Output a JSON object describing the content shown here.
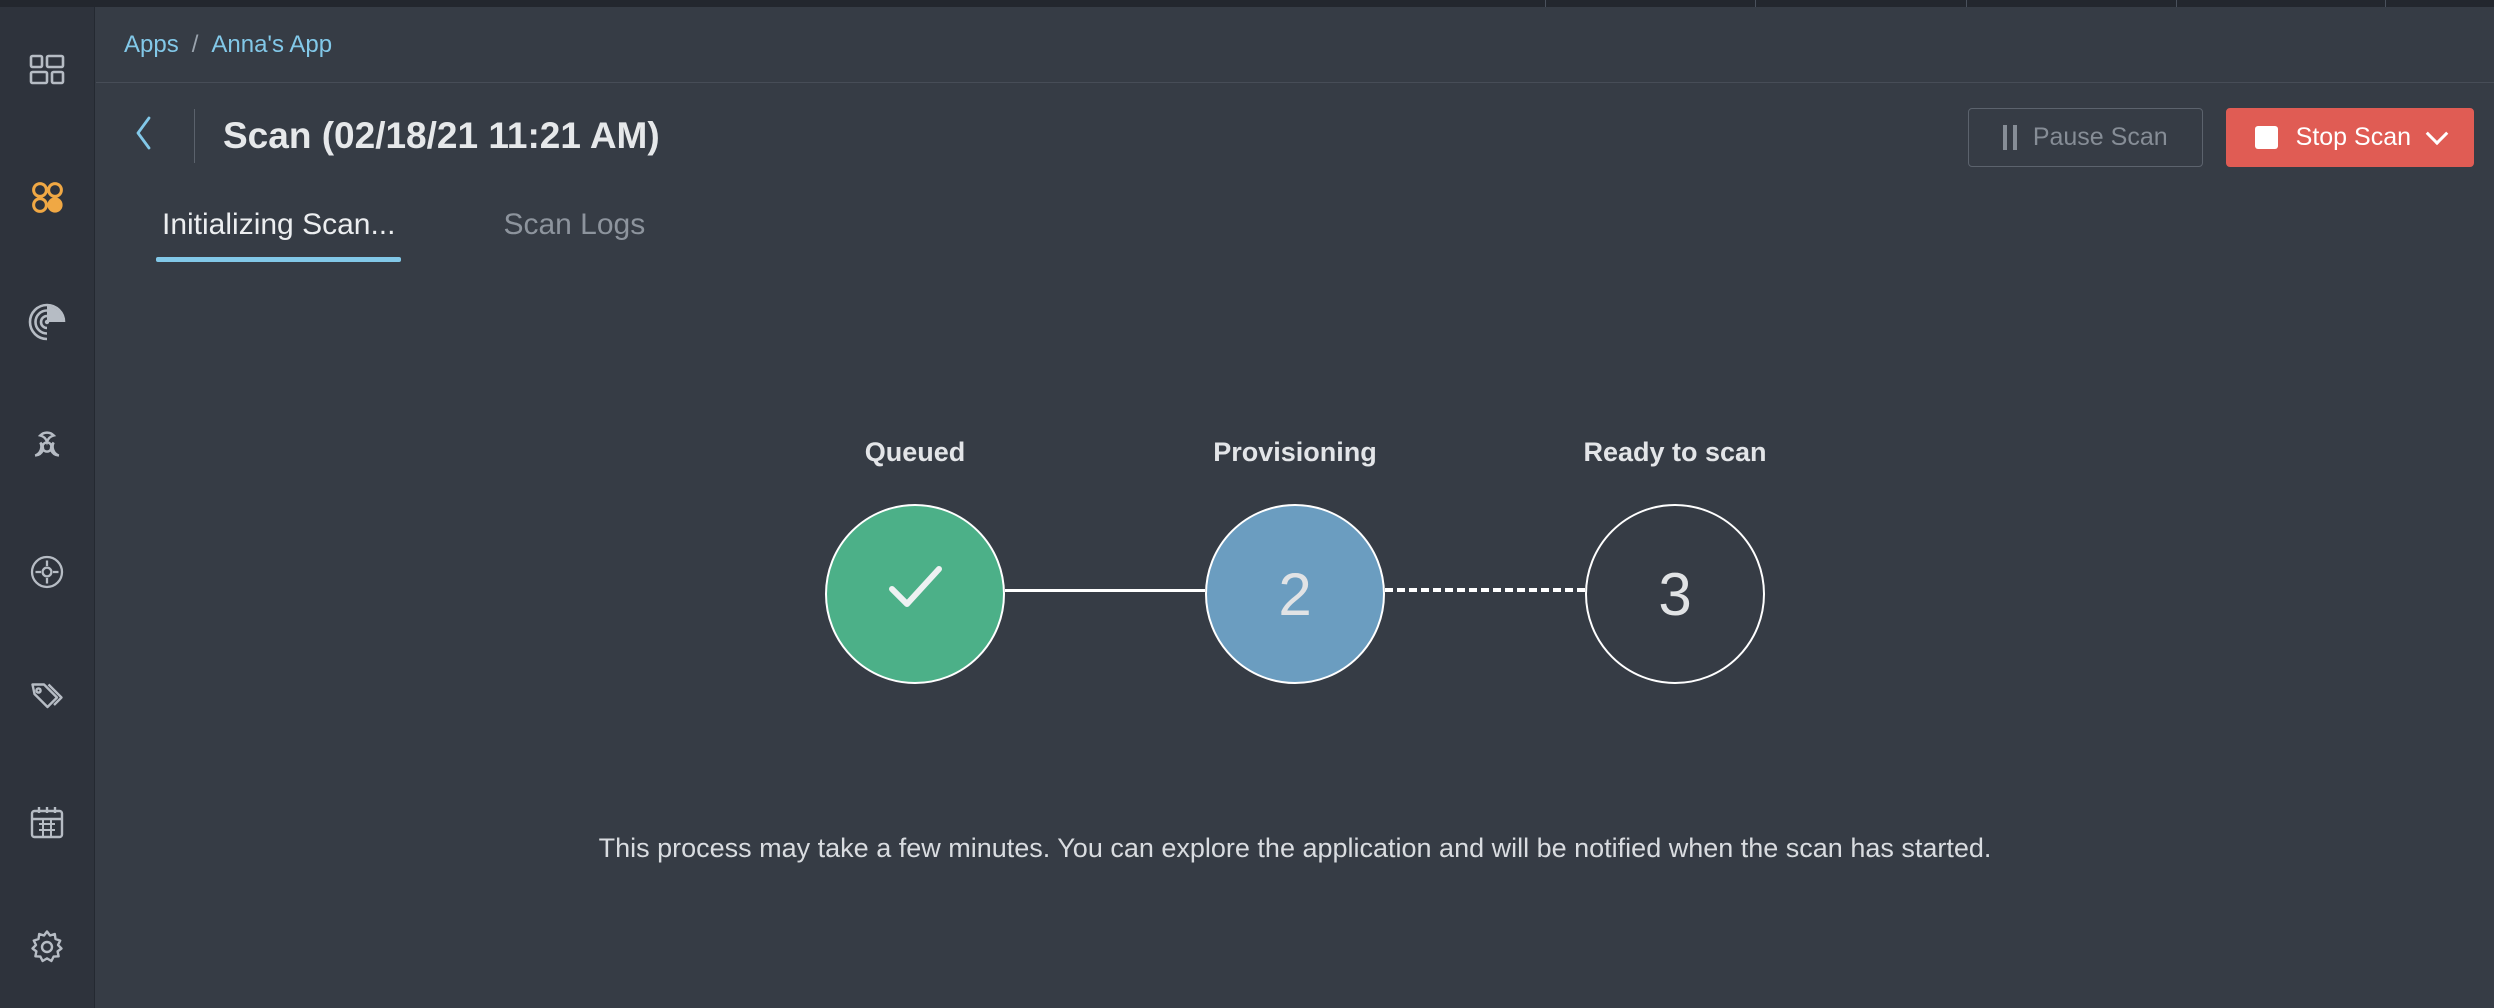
{
  "window": {
    "background": "#363c45",
    "rail_background": "#2e333c"
  },
  "sidebar": {
    "items": [
      {
        "name": "dashboard-grid-icon",
        "label": "Dashboard",
        "active": false,
        "color": "#b6bcc4"
      },
      {
        "name": "apps-circles-icon",
        "label": "Apps",
        "active": true,
        "color": "#f0a844"
      },
      {
        "name": "radar-scan-icon",
        "label": "Scans",
        "active": false,
        "color": "#b6bcc4"
      },
      {
        "name": "biohazard-icon",
        "label": "Vulnerabilities",
        "active": false,
        "color": "#b6bcc4"
      },
      {
        "name": "target-crosshair-icon",
        "label": "Targets",
        "active": false,
        "color": "#b6bcc4"
      },
      {
        "name": "tag-icon",
        "label": "Tags",
        "active": false,
        "color": "#b6bcc4"
      },
      {
        "name": "calendar-icon",
        "label": "Schedule",
        "active": false,
        "color": "#b6bcc4"
      },
      {
        "name": "gear-icon",
        "label": "Settings",
        "active": false,
        "color": "#b6bcc4"
      }
    ]
  },
  "breadcrumb": {
    "items": [
      "Apps",
      "Anna's App"
    ],
    "separator": "/",
    "link_color": "#82c8e8"
  },
  "header": {
    "back_icon": "chevron-left-icon",
    "title": "Scan (02/18/21 11:21 AM)",
    "pause_button": {
      "label": "Pause Scan",
      "icon": "pause-icon",
      "disabled": true
    },
    "stop_button": {
      "label": "Stop Scan",
      "icon": "stop-square-icon",
      "dropdown_icon": "chevron-down-icon",
      "color": "#e05c54"
    }
  },
  "tabs": {
    "accent_color": "#82c8e8",
    "items": [
      {
        "label": "Initializing Scan...",
        "active": true
      },
      {
        "label": "Scan Logs",
        "active": false
      }
    ]
  },
  "stepper": {
    "steps": [
      {
        "label": "Queued",
        "value": "✓",
        "state": "done",
        "color": "#4cb088"
      },
      {
        "label": "Provisioning",
        "value": "2",
        "state": "current",
        "color": "#6b9dc0"
      },
      {
        "label": "Ready to scan",
        "value": "3",
        "state": "todo",
        "color": "transparent"
      }
    ],
    "connectors": [
      "solid",
      "dashed"
    ]
  },
  "note": {
    "text": "This process may take a few minutes. You can explore the application and will be notified when the scan has started."
  }
}
